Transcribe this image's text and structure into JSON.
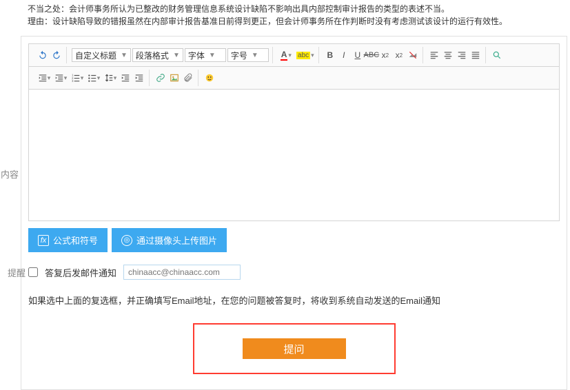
{
  "top": {
    "line1": "不当之处：会计师事务所认为已整改的财务管理信息系统设计缺陷不影响出具内部控制审计报告的类型的表述不当。",
    "line2": "理由：设计缺陷导致的错报虽然在内部审计报告基准日前得到更正，但会计师事务所在作判断时没有考虑测试该设计的运行有效性。"
  },
  "labels": {
    "content": "内容",
    "reminder": "提醒"
  },
  "toolbar": {
    "custom_title": "自定义标题",
    "para_format": "段落格式",
    "font_family": "字体",
    "font_size": "字号",
    "A": "A",
    "abc": "abc"
  },
  "actions": {
    "formula": "公式和符号",
    "camera_upload": "通过摄像头上传图片"
  },
  "reminder": {
    "checkbox_label": "答复后发邮件通知",
    "email_placeholder": "chinaacc@chinaacc.com",
    "hint": "如果选中上面的复选框，并正确填写Email地址，在您的问题被答复时，将收到系统自动发送的Email通知"
  },
  "submit": {
    "label": "提问"
  }
}
